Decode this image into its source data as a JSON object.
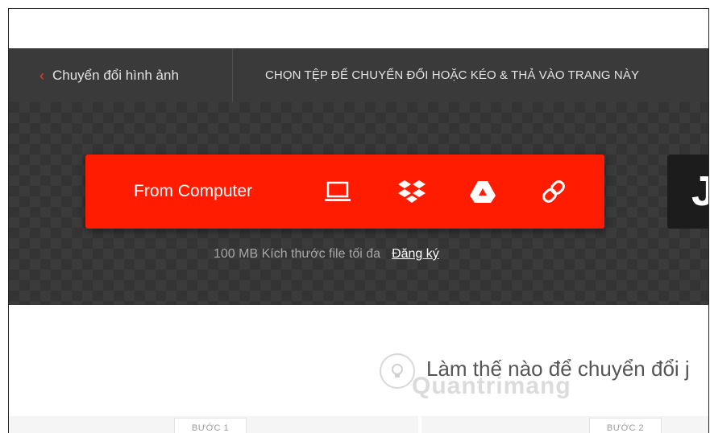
{
  "subnav": {
    "back_label": "Chuyển đổi hình ảnh",
    "hint": "CHỌN TỆP ĐỂ CHUYỂN ĐỔI HOẶC KÉO & THẢ VÀO TRANG NÀY"
  },
  "upload": {
    "from_label": "From Computer",
    "sources": [
      "laptop-icon",
      "dropbox-icon",
      "google-drive-icon",
      "link-icon"
    ],
    "accent": "#ff1c00"
  },
  "limit": {
    "text": "100 MB Kích thước file tối đa",
    "signup": "Đăng ký"
  },
  "right_tile": {
    "letter": "J"
  },
  "howto": {
    "heading": "Làm thế nào để chuyển đổi j",
    "watermark": "Quantrimang"
  },
  "steps": {
    "step1": "BƯỚC 1",
    "step2": "BƯỚC 2"
  },
  "colors": {
    "dark_bg": "#343434",
    "subnav_bg": "#3a3a3a",
    "chevron": "#ef3b2d"
  }
}
